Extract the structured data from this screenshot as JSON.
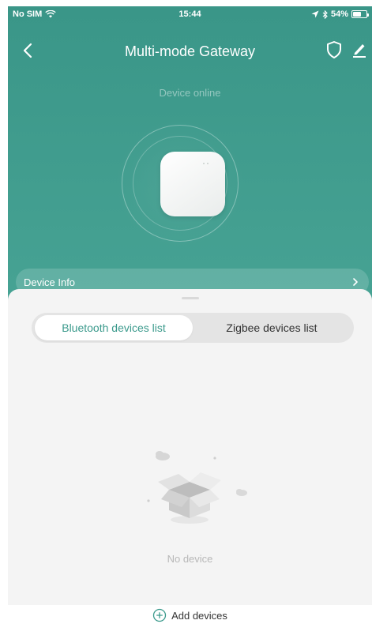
{
  "status_bar": {
    "carrier": "No SIM",
    "time": "15:44",
    "battery": "54%",
    "battery_level_percent": 54
  },
  "nav": {
    "title": "Multi-mode Gateway",
    "back_icon": "chevron-left-icon",
    "shield_icon": "shield-icon",
    "edit_icon": "edit-icon"
  },
  "device": {
    "status": "Device online",
    "image_icon": "gateway-device-icon"
  },
  "info_bar": {
    "label": "Device Info",
    "chevron_icon": "chevron-right-icon"
  },
  "tabs": [
    {
      "label": "Bluetooth devices list",
      "active": true
    },
    {
      "label": "Zigbee devices list",
      "active": false
    }
  ],
  "empty_state": {
    "text": "No device",
    "illustration_icon": "empty-box-icon"
  },
  "add": {
    "label": "Add devices",
    "icon": "plus-circle-icon"
  },
  "colors": {
    "accent": "#3b9a8c",
    "header_bg": "#3e9a8c",
    "sheet_bg": "#f4f4f4"
  }
}
